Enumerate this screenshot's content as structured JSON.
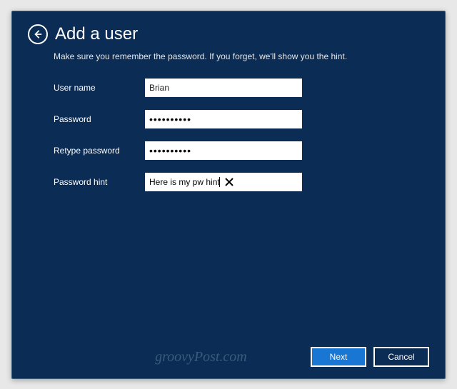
{
  "header": {
    "title": "Add a user",
    "subtitle": "Make sure you remember the password. If you forget, we'll show you the hint."
  },
  "form": {
    "username": {
      "label": "User name",
      "value": "Brian"
    },
    "password": {
      "label": "Password",
      "value": "••••••••••"
    },
    "retype": {
      "label": "Retype password",
      "value": "••••••••••"
    },
    "hint": {
      "label": "Password hint",
      "value": "Here is my pw hint"
    }
  },
  "footer": {
    "next": "Next",
    "cancel": "Cancel"
  },
  "watermark": "groovyPost.com"
}
